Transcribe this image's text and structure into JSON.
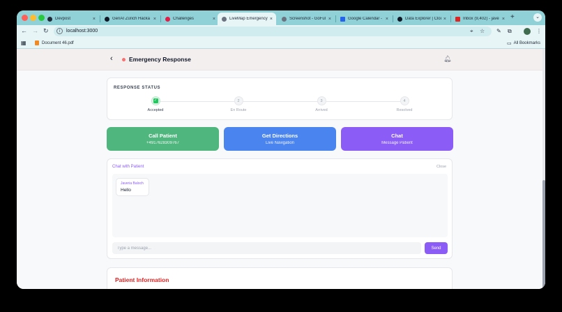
{
  "browser": {
    "tabs": [
      {
        "title": "Devpost",
        "favicon_color": "#1f2937"
      },
      {
        "title": "GenAI Zürich Hacka",
        "favicon_color": "#111827"
      },
      {
        "title": "Challenges",
        "favicon_color": "#e11d48"
      },
      {
        "title": "LiveMap Emergency",
        "favicon_color": "#6b7280"
      },
      {
        "title": "Screenshot - GoFul",
        "favicon_color": "#6b7280"
      },
      {
        "title": "Google Calendar - V",
        "favicon_color": "#2563eb"
      },
      {
        "title": "Data Explorer | Clou",
        "favicon_color": "#111827"
      },
      {
        "title": "Inbox (9,402) - jave",
        "favicon_color": "#dc2626"
      }
    ],
    "active_tab_index": 3,
    "tab_close": "×",
    "new_tab": "+",
    "tab_menu": "⌄",
    "url": "localhost:3000",
    "bookmark": "Document 46.pdf",
    "all_bookmarks": "All Bookmarks"
  },
  "header": {
    "title": "Emergency Response"
  },
  "status": {
    "title": "RESPONSE STATUS",
    "steps": [
      {
        "number": "",
        "label": "Accepted",
        "done": true
      },
      {
        "number": "2",
        "label": "En Route",
        "done": false
      },
      {
        "number": "3",
        "label": "Arrived",
        "done": false
      },
      {
        "number": "4",
        "label": "Resolved",
        "done": false
      }
    ]
  },
  "actions": [
    {
      "title": "Call Patient",
      "subtitle": "+4917628309767",
      "color": "#4fb67e"
    },
    {
      "title": "Get Directions",
      "subtitle": "Live Navigation",
      "color": "#4a84ee"
    },
    {
      "title": "Chat",
      "subtitle": "Message Patient",
      "color": "#8b5cf6"
    }
  ],
  "chat": {
    "title": "Chat with Patient",
    "close": "Close",
    "messages": [
      {
        "sender": "Javeria Baloch",
        "text": "Hello"
      }
    ],
    "placeholder": "Type a message...",
    "send": "Send"
  },
  "patient": {
    "title": "Patient Information"
  }
}
